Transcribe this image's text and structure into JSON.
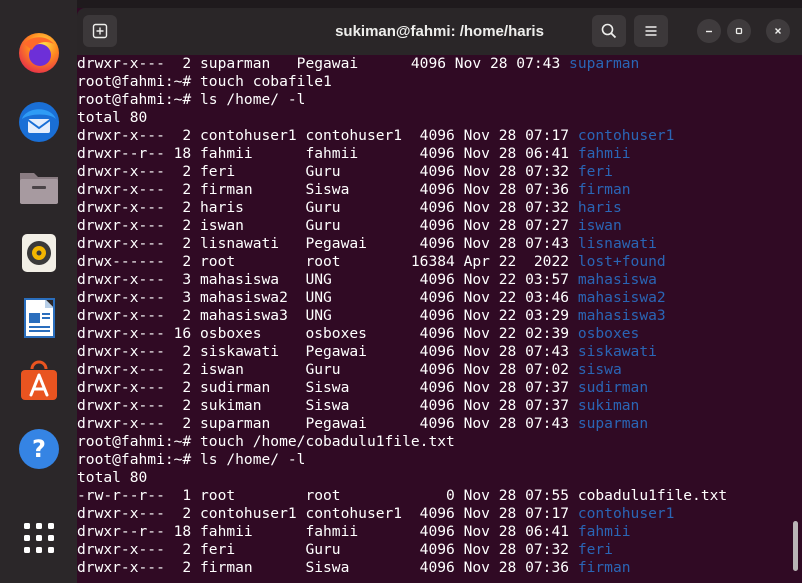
{
  "window": {
    "title": "sukiman@fahmi: /home/haris"
  },
  "dock": {
    "items": [
      {
        "name": "firefox-icon"
      },
      {
        "name": "thunderbird-icon"
      },
      {
        "name": "files-icon"
      },
      {
        "name": "rhythmbox-icon"
      },
      {
        "name": "libreoffice-writer-icon"
      },
      {
        "name": "app-center-icon"
      },
      {
        "name": "help-icon"
      },
      {
        "name": "show-apps-icon"
      }
    ]
  },
  "colors": {
    "terminal_bg": "#300a24",
    "directory": "#2a65b5",
    "text": "#ffffff"
  },
  "terminal": {
    "lines": [
      {
        "type": "entry",
        "pre": "drwxr-x---  2 suparman   Pegawai      4096 Nov 28 07:43 ",
        "name": "suparman",
        "kind": "dir"
      },
      {
        "type": "text",
        "text": "root@fahmi:~# touch cobafile1"
      },
      {
        "type": "text",
        "text": "root@fahmi:~# ls /home/ -l"
      },
      {
        "type": "text",
        "text": "total 80"
      },
      {
        "type": "entry",
        "pre": "drwxr-x---  2 contohuser1 contohuser1  4096 Nov 28 07:17 ",
        "name": "contohuser1",
        "kind": "dir"
      },
      {
        "type": "entry",
        "pre": "drwxr--r-- 18 fahmii      fahmii       4096 Nov 28 06:41 ",
        "name": "fahmii",
        "kind": "dir"
      },
      {
        "type": "entry",
        "pre": "drwxr-x---  2 feri        Guru         4096 Nov 28 07:32 ",
        "name": "feri",
        "kind": "dir"
      },
      {
        "type": "entry",
        "pre": "drwxr-x---  2 firman      Siswa        4096 Nov 28 07:36 ",
        "name": "firman",
        "kind": "dir"
      },
      {
        "type": "entry",
        "pre": "drwxr-x---  2 haris       Guru         4096 Nov 28 07:32 ",
        "name": "haris",
        "kind": "dir"
      },
      {
        "type": "entry",
        "pre": "drwxr-x---  2 iswan       Guru         4096 Nov 28 07:27 ",
        "name": "iswan",
        "kind": "dir"
      },
      {
        "type": "entry",
        "pre": "drwxr-x---  2 lisnawati   Pegawai      4096 Nov 28 07:43 ",
        "name": "lisnawati",
        "kind": "dir"
      },
      {
        "type": "entry",
        "pre": "drwx------  2 root        root        16384 Apr 22  2022 ",
        "name": "lost+found",
        "kind": "dir"
      },
      {
        "type": "entry",
        "pre": "drwxr-x---  3 mahasiswa   UNG          4096 Nov 22 03:57 ",
        "name": "mahasiswa",
        "kind": "dir"
      },
      {
        "type": "entry",
        "pre": "drwxr-x---  3 mahasiswa2  UNG          4096 Nov 22 03:46 ",
        "name": "mahasiswa2",
        "kind": "dir"
      },
      {
        "type": "entry",
        "pre": "drwxr-x---  2 mahasiswa3  UNG          4096 Nov 22 03:29 ",
        "name": "mahasiswa3",
        "kind": "dir"
      },
      {
        "type": "entry",
        "pre": "drwxr-x--- 16 osboxes     osboxes      4096 Nov 22 02:39 ",
        "name": "osboxes",
        "kind": "dir"
      },
      {
        "type": "entry",
        "pre": "drwxr-x---  2 siskawati   Pegawai      4096 Nov 28 07:43 ",
        "name": "siskawati",
        "kind": "dir"
      },
      {
        "type": "entry",
        "pre": "drwxr-x---  2 iswan       Guru         4096 Nov 28 07:02 ",
        "name": "siswa",
        "kind": "dir"
      },
      {
        "type": "entry",
        "pre": "drwxr-x---  2 sudirman    Siswa        4096 Nov 28 07:37 ",
        "name": "sudirman",
        "kind": "dir"
      },
      {
        "type": "entry",
        "pre": "drwxr-x---  2 sukiman     Siswa        4096 Nov 28 07:37 ",
        "name": "sukiman",
        "kind": "dir"
      },
      {
        "type": "entry",
        "pre": "drwxr-x---  2 suparman    Pegawai      4096 Nov 28 07:43 ",
        "name": "suparman",
        "kind": "dir"
      },
      {
        "type": "text",
        "text": "root@fahmi:~# touch /home/cobadulu1file.txt"
      },
      {
        "type": "text",
        "text": "root@fahmi:~# ls /home/ -l"
      },
      {
        "type": "text",
        "text": "total 80"
      },
      {
        "type": "entry",
        "pre": "-rw-r--r--  1 root        root            0 Nov 28 07:55 ",
        "name": "cobadulu1file.txt",
        "kind": "file"
      },
      {
        "type": "entry",
        "pre": "drwxr-x---  2 contohuser1 contohuser1  4096 Nov 28 07:17 ",
        "name": "contohuser1",
        "kind": "dir"
      },
      {
        "type": "entry",
        "pre": "drwxr--r-- 18 fahmii      fahmii       4096 Nov 28 06:41 ",
        "name": "fahmii",
        "kind": "dir"
      },
      {
        "type": "entry",
        "pre": "drwxr-x---  2 feri        Guru         4096 Nov 28 07:32 ",
        "name": "feri",
        "kind": "dir"
      },
      {
        "type": "entry",
        "pre": "drwxr-x---  2 firman      Siswa        4096 Nov 28 07:36 ",
        "name": "firman",
        "kind": "dir"
      }
    ]
  }
}
